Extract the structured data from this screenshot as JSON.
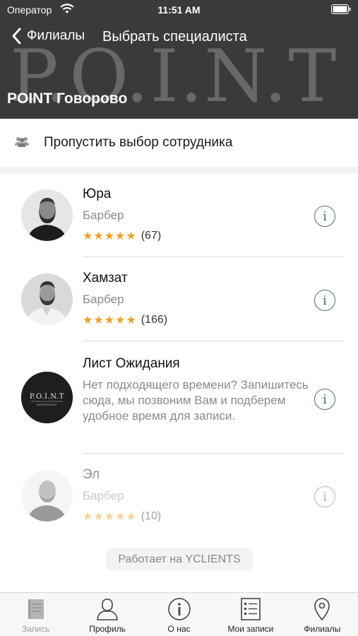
{
  "status_bar": {
    "carrier": "Оператор",
    "time": "11:51 AM"
  },
  "header": {
    "background_brand": "P.O.I.N.T",
    "back_label": "Филиалы",
    "title": "Выбрать специалиста",
    "branch_name": "POINT Говорово"
  },
  "skip": {
    "label": "Пропустить выбор сотрудника",
    "icon": "people-icon"
  },
  "staff": [
    {
      "name": "Юра",
      "role": "Барбер",
      "stars": "★★★★★",
      "rating_count": "(67)"
    },
    {
      "name": "Хамзат",
      "role": "Барбер",
      "stars": "★★★★★",
      "rating_count": "(166)"
    },
    {
      "name": "Лист Ожидания",
      "description": "Нет подходящего времени? Запишитесь сюда, мы позвоним Вам и подберем удобное время для записи.",
      "logo_text": "P.O.I.N.T",
      "logo_subtext": "BARBERSHOP"
    },
    {
      "name": "Эл",
      "role": "Барбер",
      "stars": "★★★★★",
      "rating_count": "(10)"
    }
  ],
  "powered_by": "Работает на YCLIENTS",
  "tabs": [
    {
      "label": "Запись",
      "icon": "book-icon",
      "active": false
    },
    {
      "label": "Профиль",
      "icon": "profile-icon",
      "active": true
    },
    {
      "label": "О нас",
      "icon": "info-icon",
      "active": true
    },
    {
      "label": "Мои записи",
      "icon": "list-icon",
      "active": true
    },
    {
      "label": "Филиалы",
      "icon": "map-pin-icon",
      "active": true
    }
  ],
  "colors": {
    "header_bg": "#3a3a3a",
    "star": "#f0a020",
    "info_accent": "#4e6e72"
  }
}
